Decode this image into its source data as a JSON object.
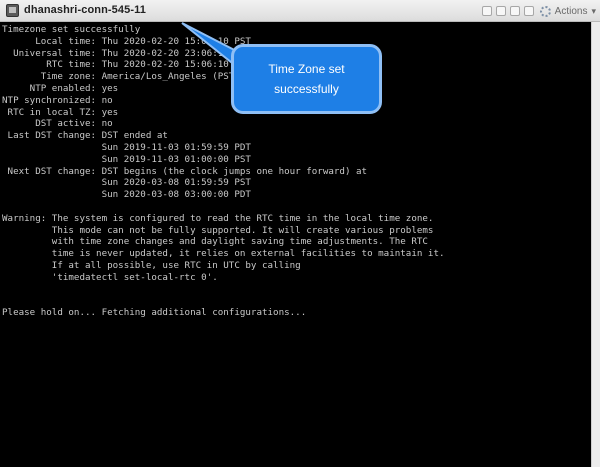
{
  "window": {
    "title": "dhanashri-conn-545-11",
    "actions_label": "Actions",
    "actions_chevron": "▾"
  },
  "icons": {
    "app": "terminal-app-icon",
    "gear": "gear-icon"
  },
  "terminal": {
    "lines": [
      "Timezone set successfully",
      "      Local time: Thu 2020-02-20 15:06:10 PST",
      "  Universal time: Thu 2020-02-20 23:06:10 UTC",
      "        RTC time: Thu 2020-02-20 15:06:10",
      "       Time zone: America/Los_Angeles (PST, -0800)",
      "     NTP enabled: yes",
      "NTP synchronized: no",
      " RTC in local TZ: yes",
      "      DST active: no",
      " Last DST change: DST ended at",
      "                  Sun 2019-11-03 01:59:59 PDT",
      "                  Sun 2019-11-03 01:00:00 PST",
      " Next DST change: DST begins (the clock jumps one hour forward) at",
      "                  Sun 2020-03-08 01:59:59 PST",
      "                  Sun 2020-03-08 03:00:00 PDT",
      "",
      "Warning: The system is configured to read the RTC time in the local time zone.",
      "         This mode can not be fully supported. It will create various problems",
      "         with time zone changes and daylight saving time adjustments. The RTC",
      "         time is never updated, it relies on external facilities to maintain it.",
      "         If at all possible, use RTC in UTC by calling",
      "         'timedatectl set-local-rtc 0'.",
      "",
      "",
      "Please hold on... Fetching additional configurations..."
    ]
  },
  "callout": {
    "line1": "Time Zone set",
    "line2": "successfully"
  },
  "colors": {
    "terminal_bg": "#000000",
    "terminal_fg": "#c9c9c9",
    "callout_bg": "#1e7fe6",
    "callout_border": "#8fbff5"
  }
}
